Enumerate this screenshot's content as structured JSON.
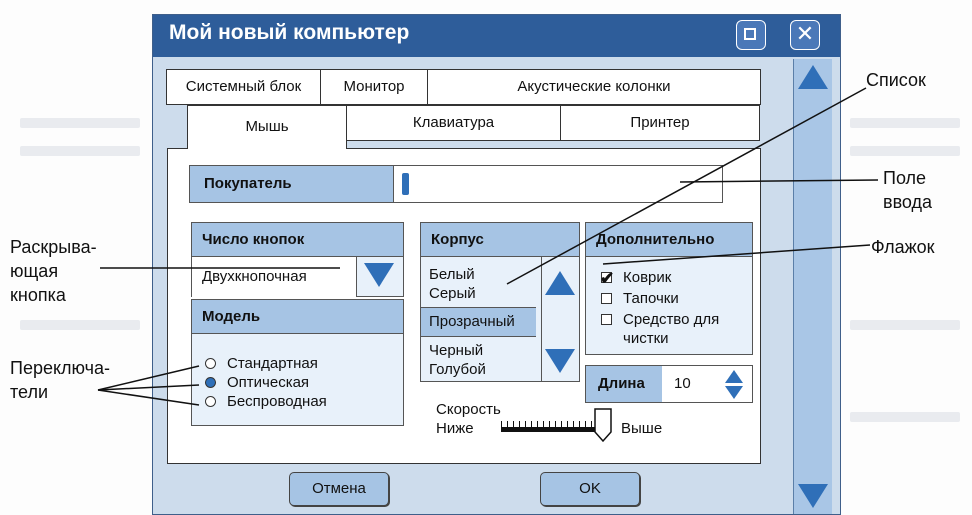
{
  "window": {
    "title": "Мой новый компьютер",
    "close_symbol": "✕"
  },
  "tabs": {
    "row1": [
      "Системный блок",
      "Монитор",
      "Акустические колонки"
    ],
    "row2": [
      "Мышь",
      "Клавиатура",
      "Принтер"
    ]
  },
  "buyer": {
    "label": "Покупатель",
    "value": ""
  },
  "buttons_count": {
    "label": "Число кнопок",
    "value": "Двухкнопочная"
  },
  "model": {
    "label": "Модель",
    "options": [
      "Стандартная",
      "Оптическая",
      "Беспроводная"
    ],
    "selected": "Оптическая"
  },
  "case": {
    "label": "Корпус",
    "items": [
      "Белый",
      "Серый",
      "Прозрачный",
      "Черный",
      "Голубой"
    ],
    "selected": "Прозрачный"
  },
  "extra": {
    "label": "Дополнительно",
    "options": [
      "Коврик",
      "Тапочки",
      "Средство для",
      "чистки"
    ],
    "checked": [
      "Коврик"
    ]
  },
  "length": {
    "label": "Длина",
    "value": "10"
  },
  "speed": {
    "label": "Скорость",
    "low": "Ниже",
    "high": "Выше"
  },
  "footer": {
    "cancel": "Отмена",
    "ok": "OK"
  },
  "callouts": {
    "list": "Список",
    "input_1": "Поле",
    "input_2": "ввода",
    "checkbox": "Флажок",
    "dropdown_1": "Раскрыва-",
    "dropdown_2": "ющая",
    "dropdown_3": "кнопка",
    "radio_1": "Переключа-",
    "radio_2": "тели"
  },
  "colors": {
    "titlebar": "#2e5d9a",
    "accent": "#2f6fb8",
    "header_fill": "#a6c4e4",
    "window_bg": "#cddcec"
  }
}
